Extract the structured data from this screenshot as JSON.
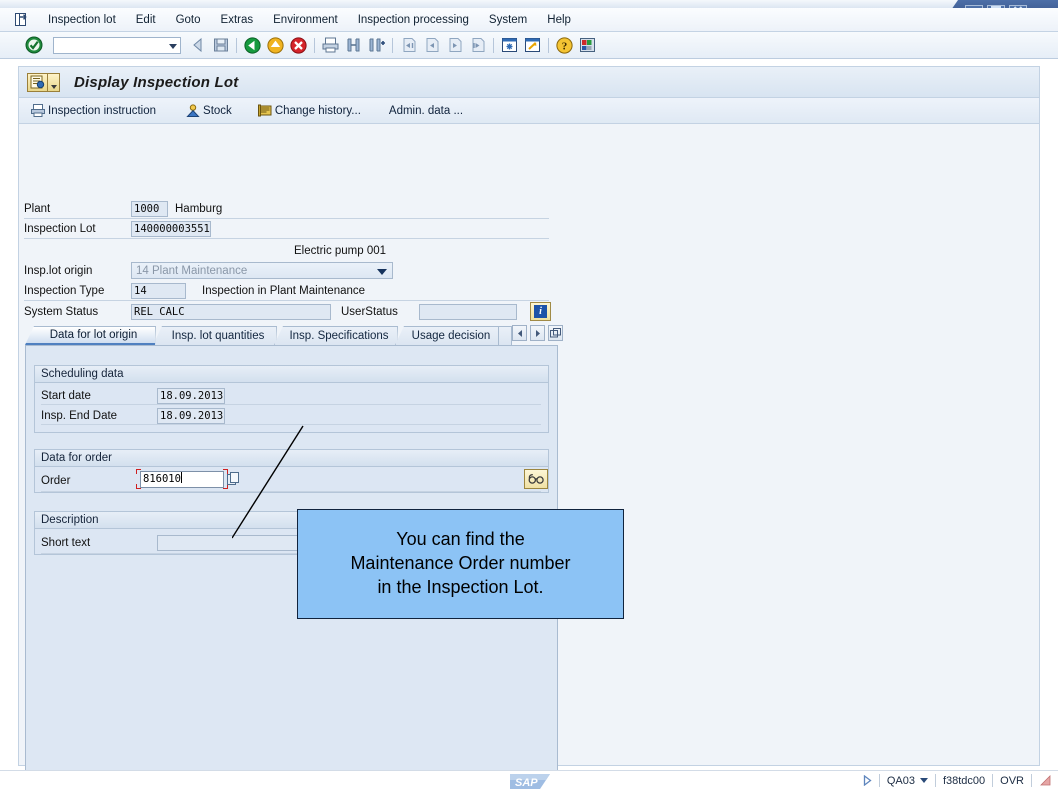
{
  "window": {
    "minimize_label": "_",
    "maximize_label": "□",
    "close_label": "×"
  },
  "menubar": {
    "system_icon": "system-menu-icon",
    "items": [
      "Inspection lot",
      "Edit",
      "Goto",
      "Extras",
      "Environment",
      "Inspection processing",
      "System",
      "Help"
    ]
  },
  "toolbar": {
    "enter_icon": "enter-check-icon",
    "command_field_value": "",
    "command_field_placeholder": "",
    "buttons": [
      "back-arrow-icon",
      "save-icon",
      "back-green-icon",
      "exit-yellow-icon",
      "cancel-red-icon",
      "print-icon",
      "find-icon",
      "find-next-icon",
      "first-page-icon",
      "previous-page-icon",
      "next-page-icon",
      "last-page-icon",
      "create-session-icon",
      "create-shortcut-icon",
      "help-icon",
      "customize-local-layout-icon"
    ]
  },
  "program": {
    "title": "Display Inspection Lot",
    "title_icon": "inspection-lot-icon",
    "appbar": [
      {
        "label": "Inspection instruction",
        "icon": "document-print-icon"
      },
      {
        "label": "Stock",
        "icon": "stock-person-icon"
      },
      {
        "label": "Change history...",
        "icon": "history-scroll-icon"
      },
      {
        "label": "Admin. data ...",
        "icon": ""
      }
    ]
  },
  "header": {
    "plant_label": "Plant",
    "plant_value": "1000",
    "plant_text": "Hamburg",
    "lot_label": "Inspection Lot",
    "lot_value": "140000003551",
    "material_text": "Electric pump 001",
    "origin_label": "Insp.lot origin",
    "origin_value": "14 Plant Maintenance",
    "insp_type_label": "Inspection Type",
    "insp_type_value": "14",
    "insp_type_text": "Inspection in Plant Maintenance",
    "system_status_label": "System Status",
    "system_status_value": "REL   CALC",
    "user_status_label": "UserStatus",
    "user_status_value": "",
    "info_icon": "info-icon"
  },
  "tabs": [
    {
      "label": "Data for lot origin",
      "active": true
    },
    {
      "label": "Insp. lot quantities",
      "active": false
    },
    {
      "label": "Insp. Specifications",
      "active": false
    },
    {
      "label": "Usage decision",
      "active": false
    }
  ],
  "tabnav": {
    "prev_icon": "chevron-left-icon",
    "next_icon": "chevron-right-icon",
    "list_icon": "tab-list-icon"
  },
  "groups": {
    "scheduling": {
      "title": "Scheduling data",
      "rows": [
        {
          "label": "Start date",
          "value": "18.09.2013"
        },
        {
          "label": "Insp. End Date",
          "value": "18.09.2013"
        }
      ]
    },
    "order": {
      "title": "Data for order",
      "row_label": "Order",
      "row_value": "816010",
      "match_icon": "matchcode-icon",
      "display_icon": "display-glasses-icon"
    },
    "description": {
      "title": "Description",
      "row_label": "Short text",
      "row_value": ""
    }
  },
  "callout": {
    "line1": "You can find the",
    "line2": "Maintenance Order number",
    "line3": "in the Inspection Lot.",
    "background_color": "#8cc3f5",
    "border_color": "#10233d"
  },
  "statusbar": {
    "sap_logo": "SAP",
    "ready_icon": "ready-triangle-icon",
    "transaction": "QA03",
    "server": "f38tdc00",
    "insert_mode": "OVR",
    "resize_icon": "resize-grip-icon"
  }
}
